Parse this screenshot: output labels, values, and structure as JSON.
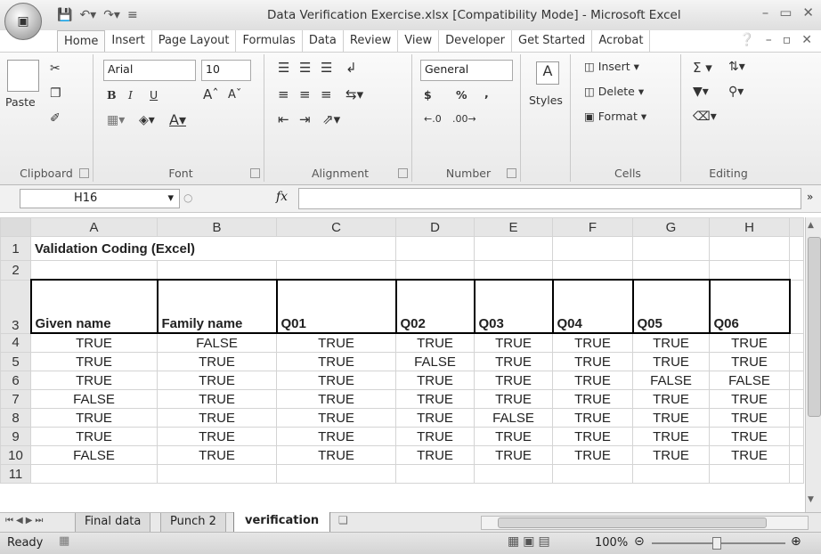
{
  "window": {
    "title": "Data Verification Exercise.xlsx  [Compatibility Mode] - Microsoft Excel",
    "controls": [
      "–",
      "▭",
      "✕"
    ]
  },
  "office_button": "Office",
  "quick_access": [
    "save-icon",
    "undo-icon",
    "redo-icon",
    "customize-icon"
  ],
  "tabs": [
    "Home",
    "Insert",
    "Page Layout",
    "Formulas",
    "Data",
    "Review",
    "View",
    "Developer",
    "Get Started",
    "Acrobat"
  ],
  "active_tab": "Home",
  "ribbon": {
    "clipboard": {
      "label": "Clipboard",
      "paste": "Paste"
    },
    "font": {
      "label": "Font",
      "name": "Arial",
      "size": "10",
      "bold": "B",
      "italic": "I",
      "underline": "U"
    },
    "alignment": {
      "label": "Alignment"
    },
    "number": {
      "label": "Number",
      "format": "General",
      "currency": "$",
      "percent": "%",
      "comma": ","
    },
    "styles": {
      "label": "Styles"
    },
    "cells": {
      "label": "Cells",
      "insert": "Insert",
      "delete": "Delete",
      "format": "Format"
    },
    "editing": {
      "label": "Editing"
    }
  },
  "formula_bar": {
    "name_box": "H16",
    "fx": "fx",
    "content": ""
  },
  "sheet": {
    "columns": [
      "A",
      "B",
      "C",
      "D",
      "E",
      "F",
      "G",
      "H"
    ],
    "title": "Validation Coding (Excel)",
    "headers": [
      "Given name",
      "Family name",
      "Q01",
      "Q02",
      "Q03",
      "Q04",
      "Q05",
      "Q06"
    ],
    "rows": [
      [
        "TRUE",
        "FALSE",
        "TRUE",
        "TRUE",
        "TRUE",
        "TRUE",
        "TRUE",
        "TRUE"
      ],
      [
        "TRUE",
        "TRUE",
        "TRUE",
        "FALSE",
        "TRUE",
        "TRUE",
        "TRUE",
        "TRUE"
      ],
      [
        "TRUE",
        "TRUE",
        "TRUE",
        "TRUE",
        "TRUE",
        "TRUE",
        "FALSE",
        "FALSE"
      ],
      [
        "FALSE",
        "TRUE",
        "TRUE",
        "TRUE",
        "TRUE",
        "TRUE",
        "TRUE",
        "TRUE"
      ],
      [
        "TRUE",
        "TRUE",
        "TRUE",
        "TRUE",
        "FALSE",
        "TRUE",
        "TRUE",
        "TRUE"
      ],
      [
        "TRUE",
        "TRUE",
        "TRUE",
        "TRUE",
        "TRUE",
        "TRUE",
        "TRUE",
        "TRUE"
      ],
      [
        "FALSE",
        "TRUE",
        "TRUE",
        "TRUE",
        "TRUE",
        "TRUE",
        "TRUE",
        "TRUE"
      ]
    ],
    "row_numbers": [
      "1",
      "2",
      "3",
      "4",
      "5",
      "6",
      "7",
      "8",
      "9",
      "10",
      "11"
    ]
  },
  "sheet_tabs": [
    "Final data",
    "Punch 2",
    "verification"
  ],
  "active_sheet": "verification",
  "status": {
    "state": "Ready",
    "zoom": "100%"
  }
}
